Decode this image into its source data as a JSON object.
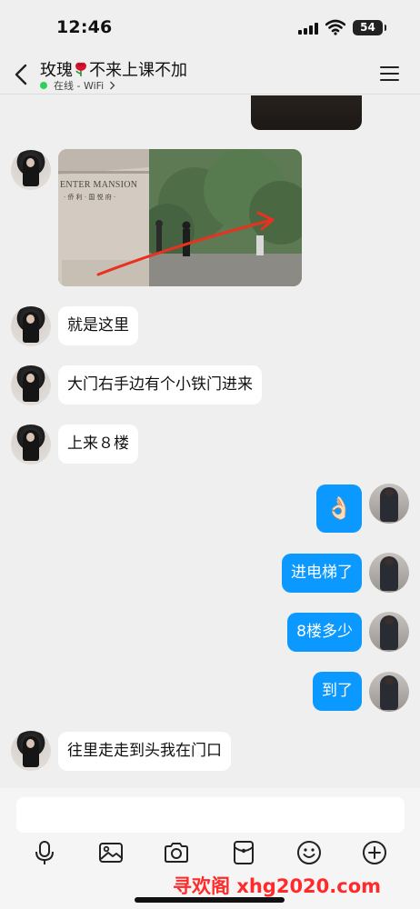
{
  "status_bar": {
    "time": "12:46",
    "battery": "54"
  },
  "header": {
    "title_before": "玫瑰",
    "title_after": "不来上课不加",
    "connection": "在线 - WiFi"
  },
  "messages": [
    {
      "from": "her",
      "type": "image"
    },
    {
      "from": "her",
      "text": "就是这里"
    },
    {
      "from": "her",
      "text": "大门右手边有个小铁门进来"
    },
    {
      "from": "her",
      "text": "上来８楼"
    },
    {
      "from": "me",
      "text": "👌🏻"
    },
    {
      "from": "me",
      "text": "进电梯了"
    },
    {
      "from": "me",
      "text": "8楼多少"
    },
    {
      "from": "me",
      "text": "到了"
    },
    {
      "from": "her",
      "text": "往里走走到头我在门口"
    }
  ],
  "photo_sign": "ENTER MANSION",
  "photo_sign_sub": "· 侨 利 · 国 悦 府 ·",
  "toolbar": {
    "icons": [
      "microphone-icon",
      "image-icon",
      "camera-icon",
      "red-packet-icon",
      "emoji-icon",
      "plus-icon"
    ]
  },
  "watermark": "寻欢阁 xhg2020.com",
  "colors": {
    "outgoing_bubble": "#0b99ff",
    "incoming_bubble": "#ffffff",
    "online_dot": "#2fd159",
    "watermark": "#ff2a2a"
  }
}
